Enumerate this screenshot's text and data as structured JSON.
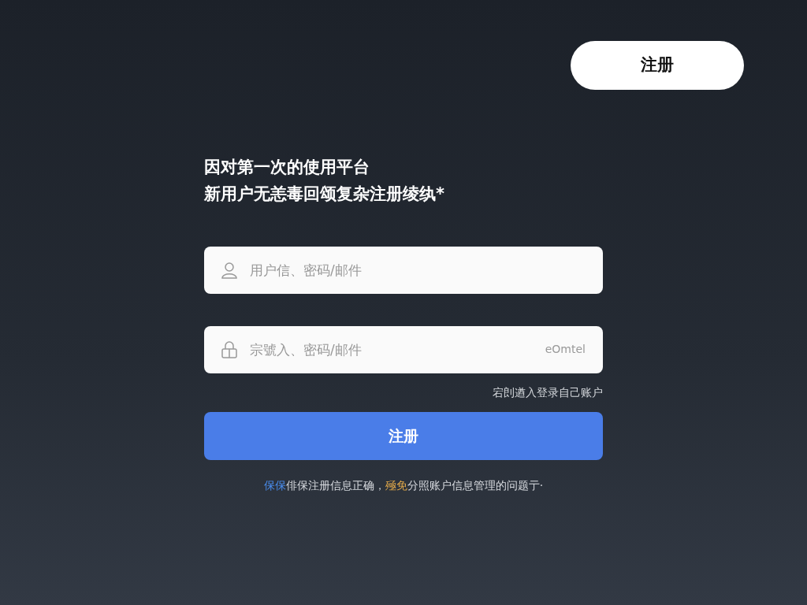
{
  "header": {
    "register_button": "注册"
  },
  "heading": {
    "lines": [
      "因对第一次的使用平台",
      "新用户无恙毒回颂复杂注册绫纨*"
    ]
  },
  "fields": [
    {
      "kind": "user",
      "placeholder": "用户信、密码/邮件"
    },
    {
      "kind": "lock",
      "placeholder": "宗號入、密码/邮件",
      "suffix": "eOmtel"
    }
  ],
  "login_link": "宕剆遒入登录自己账户",
  "submit_button": "注册",
  "notice": [
    {
      "text": "保保",
      "color": "#4a8ef0"
    },
    {
      "text": "俳保注册信息正确，",
      "color": "#d8dbe0"
    },
    {
      "text": "殛免",
      "color": "#e0a84a"
    },
    {
      "text": "分照账户信息管理的问题亍·",
      "color": "#d8dbe0"
    }
  ]
}
